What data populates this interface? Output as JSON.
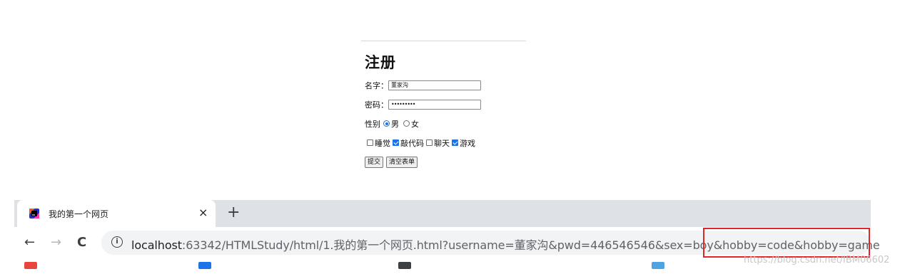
{
  "form": {
    "title": "注册",
    "name_label": "名字：",
    "name_value": "董家沟",
    "pwd_label": "密码：",
    "pwd_value": "•••••••••",
    "sex_label": "性别",
    "sex_male": "男",
    "sex_female": "女",
    "hobbies": [
      {
        "label": "睡觉",
        "checked": false
      },
      {
        "label": "敲代码",
        "checked": true
      },
      {
        "label": "聊天",
        "checked": false
      },
      {
        "label": "游戏",
        "checked": true
      }
    ],
    "submit_label": "提交",
    "reset_label": "清空表单"
  },
  "browser": {
    "tab_title": "我的第一个网页",
    "tab_close": "×",
    "new_tab": "+",
    "back": "←",
    "forward": "→",
    "reload": "C",
    "info_icon": "i",
    "url_host": "localhost",
    "url_rest": ":63342/HTMLStudy/html/1.我的第一个网页.html?username=董家沟&pwd=446546546&sex=boy&hobby=code&hobby=game",
    "accent": "#1a73e8",
    "highlight_color": "#e0262a"
  },
  "watermark": "https://blog.csdn.net/IBM06602"
}
